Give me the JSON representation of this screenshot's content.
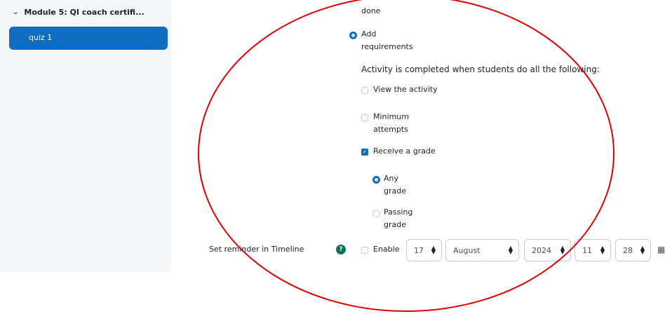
{
  "sidebar": {
    "section_title": "Module 5: QI coach certifi...",
    "items": [
      {
        "label": "quiz 1"
      }
    ]
  },
  "completion": {
    "done_text": "done",
    "add_requirements_line1": "Add",
    "add_requirements_line2": "requirements",
    "heading": "Activity is completed when students do all the following:",
    "view_activity": "View the activity",
    "minimum_line1": "Minimum",
    "minimum_line2": "attempts",
    "receive_grade": "Receive a grade",
    "any_line1": "Any",
    "any_line2": "grade",
    "passing_line1": "Passing",
    "passing_line2": "grade"
  },
  "reminder": {
    "label": "Set reminder in Timeline",
    "help": "?",
    "enable": "Enable",
    "day": "17",
    "month": "August",
    "year": "2024",
    "hour": "11",
    "minute": "28"
  },
  "colors": {
    "accent": "#0f6cbf",
    "help": "#12705f",
    "annotation": "#e00000"
  }
}
